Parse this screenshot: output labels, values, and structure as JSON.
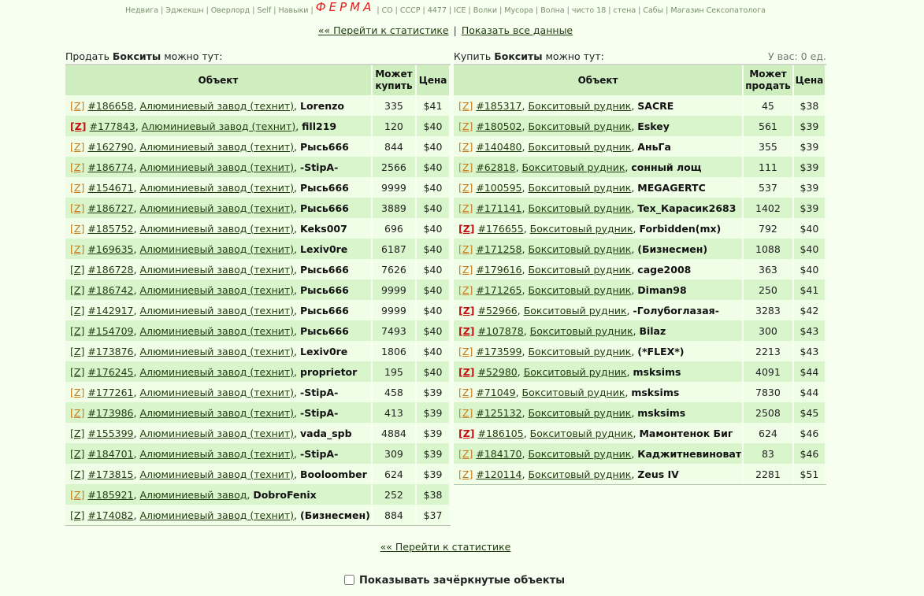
{
  "topnav": {
    "items_left": [
      "Недвига",
      "Эджекшн",
      "Оверлорд",
      "Self",
      "Навыки"
    ],
    "ferma": "ФЕРМА",
    "items_right": [
      "CO",
      "СССР",
      "4477",
      "ICE",
      "Волки",
      "Мусора",
      "Волна",
      "чисто 18",
      "стена",
      "Сабы",
      "Магазин Сексопатолога"
    ]
  },
  "links": {
    "stats": "«« Перейти к статистике",
    "separator": "|",
    "show_all": "Показать все данные"
  },
  "left": {
    "header_pre": "Продать ",
    "header_bold": "Бокситы",
    "header_post": " можно тут:",
    "col_object": "Объект",
    "col_can": "Может купить",
    "col_price": "Цена",
    "rows": [
      {
        "z": "[Z]",
        "zs": "o",
        "id": "#186658",
        "name": "Алюминиевый завод (технит)",
        "owner": "Lorenzo",
        "qty": "335",
        "price": "$41"
      },
      {
        "z": "[Z]",
        "zs": "r",
        "id": "#177843",
        "name": "Алюминиевый завод (технит)",
        "owner": "fill219",
        "qty": "120",
        "price": "$40"
      },
      {
        "z": "[Z]",
        "zs": "o",
        "id": "#162790",
        "name": "Алюминиевый завод (технит)",
        "owner": "Рысь666",
        "qty": "844",
        "price": "$40"
      },
      {
        "z": "[Z]",
        "zs": "o",
        "id": "#186774",
        "name": "Алюминиевый завод (технит)",
        "owner": "-StipA-",
        "qty": "2566",
        "price": "$40"
      },
      {
        "z": "[Z]",
        "zs": "o",
        "id": "#154671",
        "name": "Алюминиевый завод (технит)",
        "owner": "Рысь666",
        "qty": "9999",
        "price": "$40"
      },
      {
        "z": "[Z]",
        "zs": "o",
        "id": "#186727",
        "name": "Алюминиевый завод (технит)",
        "owner": "Рысь666",
        "qty": "3889",
        "price": "$40"
      },
      {
        "z": "[Z]",
        "zs": "o",
        "id": "#185752",
        "name": "Алюминиевый завод (технит)",
        "owner": "Keks007",
        "qty": "696",
        "price": "$40"
      },
      {
        "z": "[Z]",
        "zs": "o",
        "id": "#169635",
        "name": "Алюминиевый завод (технит)",
        "owner": "Lexiv0re",
        "qty": "6187",
        "price": "$40"
      },
      {
        "z": "[Z]",
        "zs": "g",
        "id": "#186728",
        "name": "Алюминиевый завод (технит)",
        "owner": "Рысь666",
        "qty": "7626",
        "price": "$40"
      },
      {
        "z": "[Z]",
        "zs": "g",
        "id": "#186742",
        "name": "Алюминиевый завод (технит)",
        "owner": "Рысь666",
        "qty": "9999",
        "price": "$40"
      },
      {
        "z": "[Z]",
        "zs": "g",
        "id": "#142917",
        "name": "Алюминиевый завод (технит)",
        "owner": "Рысь666",
        "qty": "9999",
        "price": "$40"
      },
      {
        "z": "[Z]",
        "zs": "g",
        "id": "#154709",
        "name": "Алюминиевый завод (технит)",
        "owner": "Рысь666",
        "qty": "7493",
        "price": "$40"
      },
      {
        "z": "[Z]",
        "zs": "g",
        "id": "#173876",
        "name": "Алюминиевый завод (технит)",
        "owner": "Lexiv0re",
        "qty": "1806",
        "price": "$40"
      },
      {
        "z": "[Z]",
        "zs": "g",
        "id": "#176245",
        "name": "Алюминиевый завод (технит)",
        "owner": "proprietor",
        "qty": "195",
        "price": "$40"
      },
      {
        "z": "[Z]",
        "zs": "o",
        "id": "#177261",
        "name": "Алюминиевый завод (технит)",
        "owner": "-StipA-",
        "qty": "458",
        "price": "$39"
      },
      {
        "z": "[Z]",
        "zs": "o",
        "id": "#173986",
        "name": "Алюминиевый завод (технит)",
        "owner": "-StipA-",
        "qty": "413",
        "price": "$39"
      },
      {
        "z": "[Z]",
        "zs": "g",
        "id": "#155399",
        "name": "Алюминиевый завод (технит)",
        "owner": "vada_spb",
        "qty": "4884",
        "price": "$39"
      },
      {
        "z": "[Z]",
        "zs": "g",
        "id": "#184701",
        "name": "Алюминиевый завод (технит)",
        "owner": "-StipA-",
        "qty": "309",
        "price": "$39"
      },
      {
        "z": "[Z]",
        "zs": "g",
        "id": "#173815",
        "name": "Алюминиевый завод (технит)",
        "owner": "Booloomber",
        "qty": "624",
        "price": "$39"
      },
      {
        "z": "[Z]",
        "zs": "o",
        "id": "#185921",
        "name": "Алюминиевый завод",
        "owner": "DobroFenix",
        "qty": "252",
        "price": "$38"
      },
      {
        "z": "[Z]",
        "zs": "g",
        "id": "#174082",
        "name": "Алюминиевый завод (технит)",
        "owner": "(Бизнесмен)",
        "qty": "884",
        "price": "$37"
      }
    ]
  },
  "right": {
    "header_pre": "Купить ",
    "header_bold": "Бокситы",
    "header_post": " можно тут:",
    "stock": "У вас: 0 ед.",
    "col_object": "Объект",
    "col_can": "Может продать",
    "col_price": "Цена",
    "rows": [
      {
        "z": "[Z]",
        "zs": "o",
        "id": "#185317",
        "name": "Бокситовый рудник",
        "owner": "SACRE",
        "qty": "45",
        "price": "$38"
      },
      {
        "z": "[Z]",
        "zs": "o",
        "id": "#180502",
        "name": "Бокситовый рудник",
        "owner": "Eskey",
        "qty": "561",
        "price": "$39"
      },
      {
        "z": "[Z]",
        "zs": "o",
        "id": "#140480",
        "name": "Бокситовый рудник",
        "owner": "АньГа",
        "qty": "355",
        "price": "$39"
      },
      {
        "z": "[Z]",
        "zs": "o",
        "id": "#62818",
        "name": "Бокситовый рудник",
        "owner": "сонный лощ",
        "qty": "111",
        "price": "$39"
      },
      {
        "z": "[Z]",
        "zs": "o",
        "id": "#100595",
        "name": "Бокситовый рудник",
        "owner": "MEGAGERTC",
        "qty": "537",
        "price": "$39"
      },
      {
        "z": "[Z]",
        "zs": "o",
        "id": "#171141",
        "name": "Бокситовый рудник",
        "owner": "Tex_Карасик2683",
        "qty": "1402",
        "price": "$39"
      },
      {
        "z": "[Z]",
        "zs": "r",
        "id": "#176655",
        "name": "Бокситовый рудник",
        "owner": "Forbidden(mx)",
        "qty": "792",
        "price": "$40"
      },
      {
        "z": "[Z]",
        "zs": "o",
        "id": "#171258",
        "name": "Бокситовый рудник",
        "owner": "(Бизнесмен)",
        "qty": "1088",
        "price": "$40"
      },
      {
        "z": "[Z]",
        "zs": "o",
        "id": "#179616",
        "name": "Бокситовый рудник",
        "owner": "cage2008",
        "qty": "363",
        "price": "$40"
      },
      {
        "z": "[Z]",
        "zs": "o",
        "id": "#171265",
        "name": "Бокситовый рудник",
        "owner": "Diman98",
        "qty": "250",
        "price": "$41"
      },
      {
        "z": "[Z]",
        "zs": "r",
        "id": "#52966",
        "name": "Бокситовый рудник",
        "owner": "-Голубоглазая-",
        "qty": "3283",
        "price": "$42"
      },
      {
        "z": "[Z]",
        "zs": "r",
        "id": "#107878",
        "name": "Бокситовый рудник",
        "owner": "Bilaz",
        "qty": "300",
        "price": "$43"
      },
      {
        "z": "[Z]",
        "zs": "o",
        "id": "#173599",
        "name": "Бокситовый рудник",
        "owner": "(*FLEX*)",
        "qty": "2213",
        "price": "$43"
      },
      {
        "z": "[Z]",
        "zs": "r",
        "id": "#52980",
        "name": "Бокситовый рудник",
        "owner": "msksims",
        "qty": "4091",
        "price": "$44"
      },
      {
        "z": "[Z]",
        "zs": "o",
        "id": "#71049",
        "name": "Бокситовый рудник",
        "owner": "msksims",
        "qty": "7830",
        "price": "$44"
      },
      {
        "z": "[Z]",
        "zs": "o",
        "id": "#125132",
        "name": "Бокситовый рудник",
        "owner": "msksims",
        "qty": "2508",
        "price": "$45"
      },
      {
        "z": "[Z]",
        "zs": "r",
        "id": "#186105",
        "name": "Бокситовый рудник",
        "owner": "Мамонтенок Биг",
        "qty": "624",
        "price": "$46"
      },
      {
        "z": "[Z]",
        "zs": "o",
        "id": "#184170",
        "name": "Бокситовый рудник",
        "owner": "Каджитневиноват",
        "qty": "83",
        "price": "$46"
      },
      {
        "z": "[Z]",
        "zs": "o",
        "id": "#120114",
        "name": "Бокситовый рудник",
        "owner": "Zeus IV",
        "qty": "2281",
        "price": "$51"
      }
    ]
  },
  "bottom": {
    "stats": "«« Перейти к статистике",
    "show_crossed": "Показывать зачёркнутые объекты"
  },
  "colors": {
    "z_orange": "#c87a1a",
    "z_red": "#c41010",
    "row_light": "#f0fde7",
    "row_dark": "#d9f5cc",
    "header": "#cfeec0",
    "ferma_red": "#e21c1c"
  }
}
